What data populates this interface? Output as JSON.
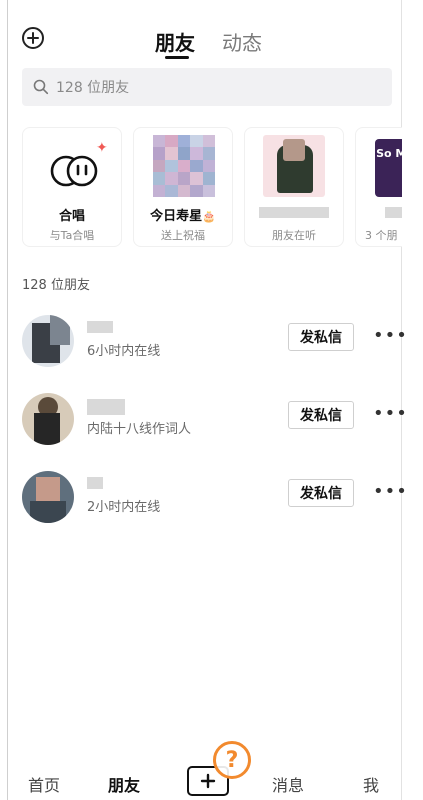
{
  "header": {
    "tabs": [
      {
        "label": "朋友",
        "active": true
      },
      {
        "label": "动态",
        "active": false
      }
    ]
  },
  "search": {
    "placeholder": "128 位朋友"
  },
  "cards": [
    {
      "title": "合唱",
      "subtitle": "与Ta合唱",
      "icon": "chorus-icon"
    },
    {
      "title": "今日寿星",
      "subtitle": "送上祝福",
      "icon": "cake-icon"
    },
    {
      "title": "",
      "subtitle": "朋友在听"
    },
    {
      "title": "",
      "subtitle": "3 个朋",
      "album_text": "So Mo"
    }
  ],
  "section": {
    "title": "128 位朋友"
  },
  "friends": [
    {
      "status": "6小时内在线",
      "button": "发私信"
    },
    {
      "status": "内陆十八线作词人",
      "button": "发私信"
    },
    {
      "status": "2小时内在线",
      "button": "发私信"
    }
  ],
  "more_symbol": "•••",
  "bottom_nav": {
    "items": [
      {
        "label": "首页",
        "active": false
      },
      {
        "label": "朋友",
        "active": true
      },
      {
        "label": "消息",
        "active": false
      },
      {
        "label": "我",
        "active": false
      }
    ],
    "help_symbol": "?"
  },
  "colors": {
    "accent_orange": "#f28a2e",
    "sparkle_red": "#f05a55",
    "search_bg": "#f1f1f3"
  }
}
